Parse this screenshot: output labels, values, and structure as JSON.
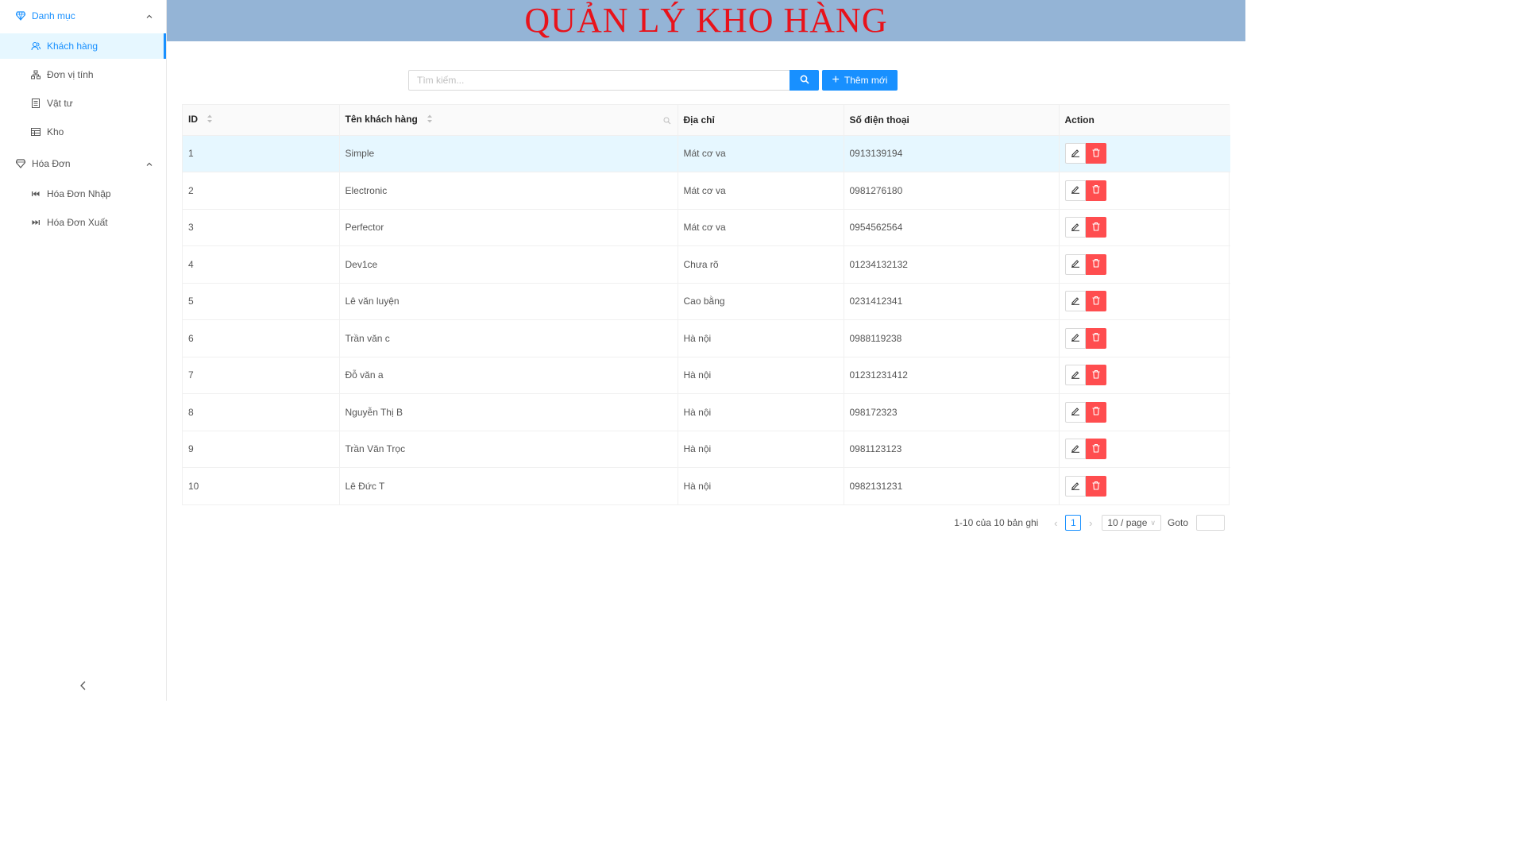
{
  "header": {
    "title": "QUẢN LÝ KHO HÀNG"
  },
  "sidebar": {
    "groups": [
      {
        "label": "Danh mục",
        "icon": "diamond-icon"
      },
      {
        "label": "Hóa Đơn",
        "icon": "tag-icon"
      }
    ],
    "items": [
      {
        "label": "Khách hàng",
        "icon": "users-icon",
        "selected": true
      },
      {
        "label": "Đơn vị tính",
        "icon": "cluster-icon"
      },
      {
        "label": "Vật tư",
        "icon": "book-icon"
      },
      {
        "label": "Kho",
        "icon": "warehouse-icon"
      },
      {
        "label": "Hóa Đơn Nhập",
        "icon": "step-backward-icon"
      },
      {
        "label": "Hóa Đơn Xuất",
        "icon": "step-forward-icon"
      }
    ]
  },
  "toolbar": {
    "search_placeholder": "Tìm kiếm...",
    "add_label": "Thêm mới"
  },
  "table": {
    "columns": [
      "ID",
      "Tên khách hàng",
      "Địa chỉ",
      "Số điện thoại",
      "Action"
    ],
    "rows": [
      {
        "id": "1",
        "name": "Simple",
        "address": "Mát cơ va",
        "phone": "0913139194"
      },
      {
        "id": "2",
        "name": "Electronic",
        "address": "Mát cơ va",
        "phone": "0981276180"
      },
      {
        "id": "3",
        "name": "Perfector",
        "address": "Mát cơ va",
        "phone": "0954562564"
      },
      {
        "id": "4",
        "name": "Dev1ce",
        "address": "Chưa rõ",
        "phone": "01234132132"
      },
      {
        "id": "5",
        "name": "Lê văn luyện",
        "address": "Cao bằng",
        "phone": "0231412341"
      },
      {
        "id": "6",
        "name": "Trần văn c",
        "address": "Hà nội",
        "phone": "0988119238"
      },
      {
        "id": "7",
        "name": "Đỗ văn a",
        "address": "Hà nội",
        "phone": "01231231412"
      },
      {
        "id": "8",
        "name": "Nguyễn Thị B",
        "address": "Hà nội",
        "phone": "098172323"
      },
      {
        "id": "9",
        "name": "Trần Văn Trọc",
        "address": "Hà nội",
        "phone": "0981123123"
      },
      {
        "id": "10",
        "name": "Lê Đức T",
        "address": "Hà nội",
        "phone": "0982131231"
      }
    ]
  },
  "pagination": {
    "total_text": "1-10 của 10 bản ghi",
    "current_page": "1",
    "page_size": "10 / page",
    "goto_label": "Goto"
  },
  "colors": {
    "primary": "#1890ff",
    "danger": "#ff4d4f",
    "header_bg": "#94b4d6",
    "title": "#e8131b"
  }
}
